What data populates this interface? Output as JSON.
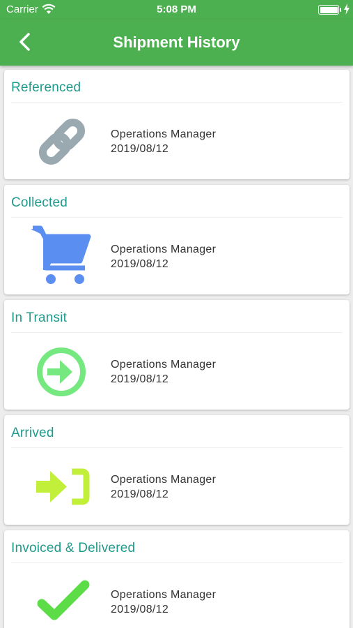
{
  "status_bar": {
    "carrier": "Carrier",
    "time": "5:08 PM"
  },
  "header": {
    "title": "Shipment History"
  },
  "colors": {
    "primary": "#4caf50",
    "title_text": "#1e9a8a",
    "referenced_icon": "#9aa9b0",
    "collected_icon": "#5b8ef1",
    "in_transit_icon": "#75e880",
    "arrived_icon": "#c2f03a",
    "delivered_icon": "#5cdc47"
  },
  "history": [
    {
      "status": "Referenced",
      "icon": "link-icon",
      "user": "Operations Manager",
      "date": "2019/08/12"
    },
    {
      "status": "Collected",
      "icon": "cart-icon",
      "user": "Operations Manager",
      "date": "2019/08/12"
    },
    {
      "status": "In Transit",
      "icon": "arrow-circle-right-icon",
      "user": "Operations Manager",
      "date": "2019/08/12"
    },
    {
      "status": "Arrived",
      "icon": "sign-in-icon",
      "user": "Operations Manager",
      "date": "2019/08/12"
    },
    {
      "status": "Invoiced & Delivered",
      "icon": "check-icon",
      "user": "Operations Manager",
      "date": "2019/08/12"
    }
  ]
}
